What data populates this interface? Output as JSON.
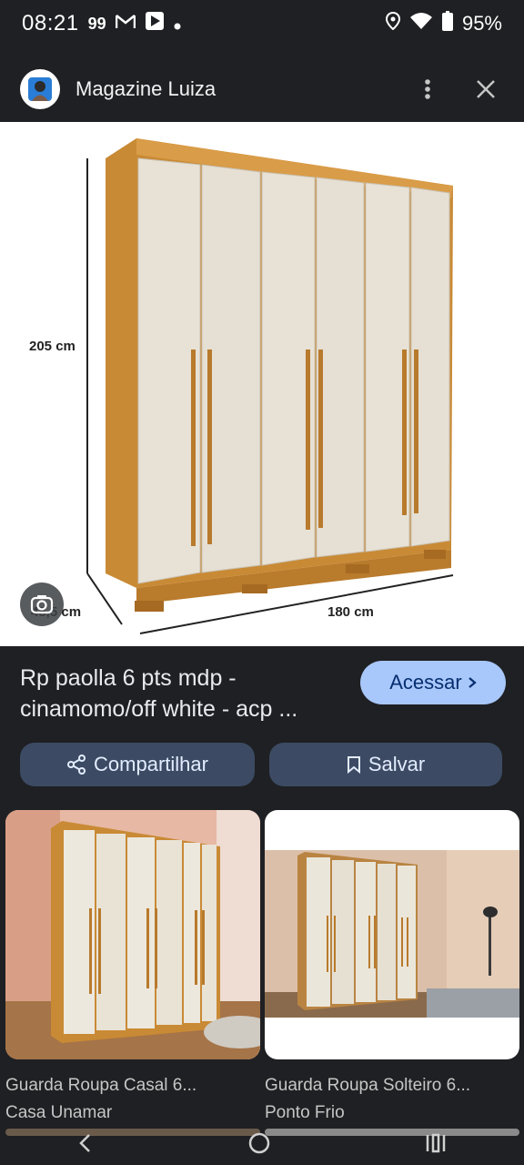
{
  "status": {
    "time": "08:21",
    "notif_count": "99",
    "battery": "95%"
  },
  "header": {
    "site_name": "Magazine Luiza",
    "menu_icon": "more-vert-icon",
    "close_icon": "close-icon"
  },
  "hero": {
    "height_label": "205 cm",
    "depth_label": "48,5 cm",
    "width_label": "180 cm"
  },
  "product": {
    "title_line1": "Rp paolla 6 pts mdp -",
    "title_line2": "cinamomo/off white - acp ...",
    "visit_label": "Acessar",
    "share_label": "Compartilhar",
    "save_label": "Salvar"
  },
  "related": [
    {
      "title": "Guarda Roupa Casal 6...",
      "source": "Casa Unamar"
    },
    {
      "title": "Guarda Roupa Solteiro 6...",
      "source": "Ponto Frio"
    }
  ],
  "colors": {
    "background": "#1f2023",
    "accent": "#a8c7fa",
    "pill": "#3c4b63",
    "wood": "#c98a35",
    "door": "#e8e2d6"
  }
}
